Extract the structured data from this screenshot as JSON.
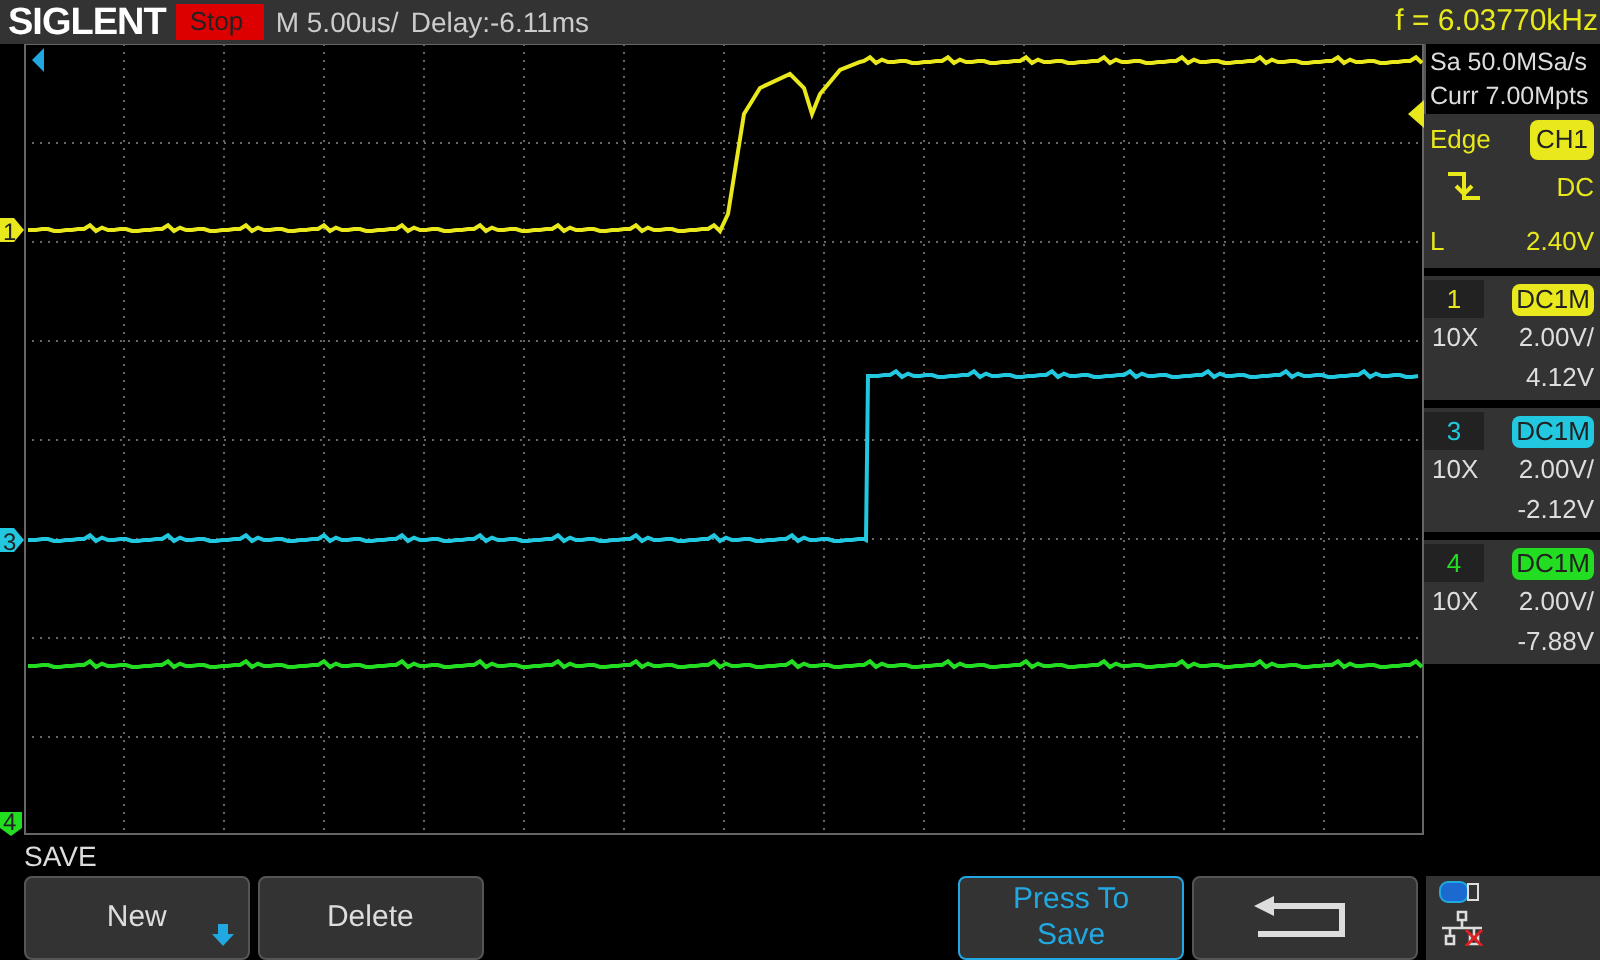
{
  "top_bar": {
    "brand": "SIGLENT",
    "run_state": "Stop",
    "timebase": "M 5.00us/",
    "delay": "Delay:-6.11ms",
    "frequency": "f = 6.03770kHz"
  },
  "acquisition": {
    "sample_rate": "Sa 50.0MSa/s",
    "memory": "Curr 7.00Mpts"
  },
  "trigger": {
    "type": "Edge",
    "source": "CH1",
    "coupling": "DC",
    "level_label": "L",
    "level_value": "2.40V"
  },
  "channels": [
    {
      "marker_label": "1",
      "number": "1",
      "color": "#e8e81c",
      "coupling": "DC1M",
      "probe": "10X",
      "scale": "2.00V/",
      "offset": "4.12V"
    },
    {
      "marker_label": "3",
      "number": "3",
      "color": "#22c8e0",
      "coupling": "DC1M",
      "probe": "10X",
      "scale": "2.00V/",
      "offset": "-2.12V"
    },
    {
      "marker_label": "4",
      "number": "4",
      "color": "#22dd22",
      "coupling": "DC1M",
      "probe": "10X",
      "scale": "2.00V/",
      "offset": "-7.88V"
    }
  ],
  "menu": {
    "title": "SAVE",
    "buttons": [
      {
        "kind": "dropdown",
        "label": "New"
      },
      {
        "kind": "plain",
        "label": "Delete"
      },
      {
        "kind": "blank"
      },
      {
        "kind": "blank"
      },
      {
        "kind": "active",
        "label": "Press To Save"
      },
      {
        "kind": "back"
      }
    ]
  }
}
